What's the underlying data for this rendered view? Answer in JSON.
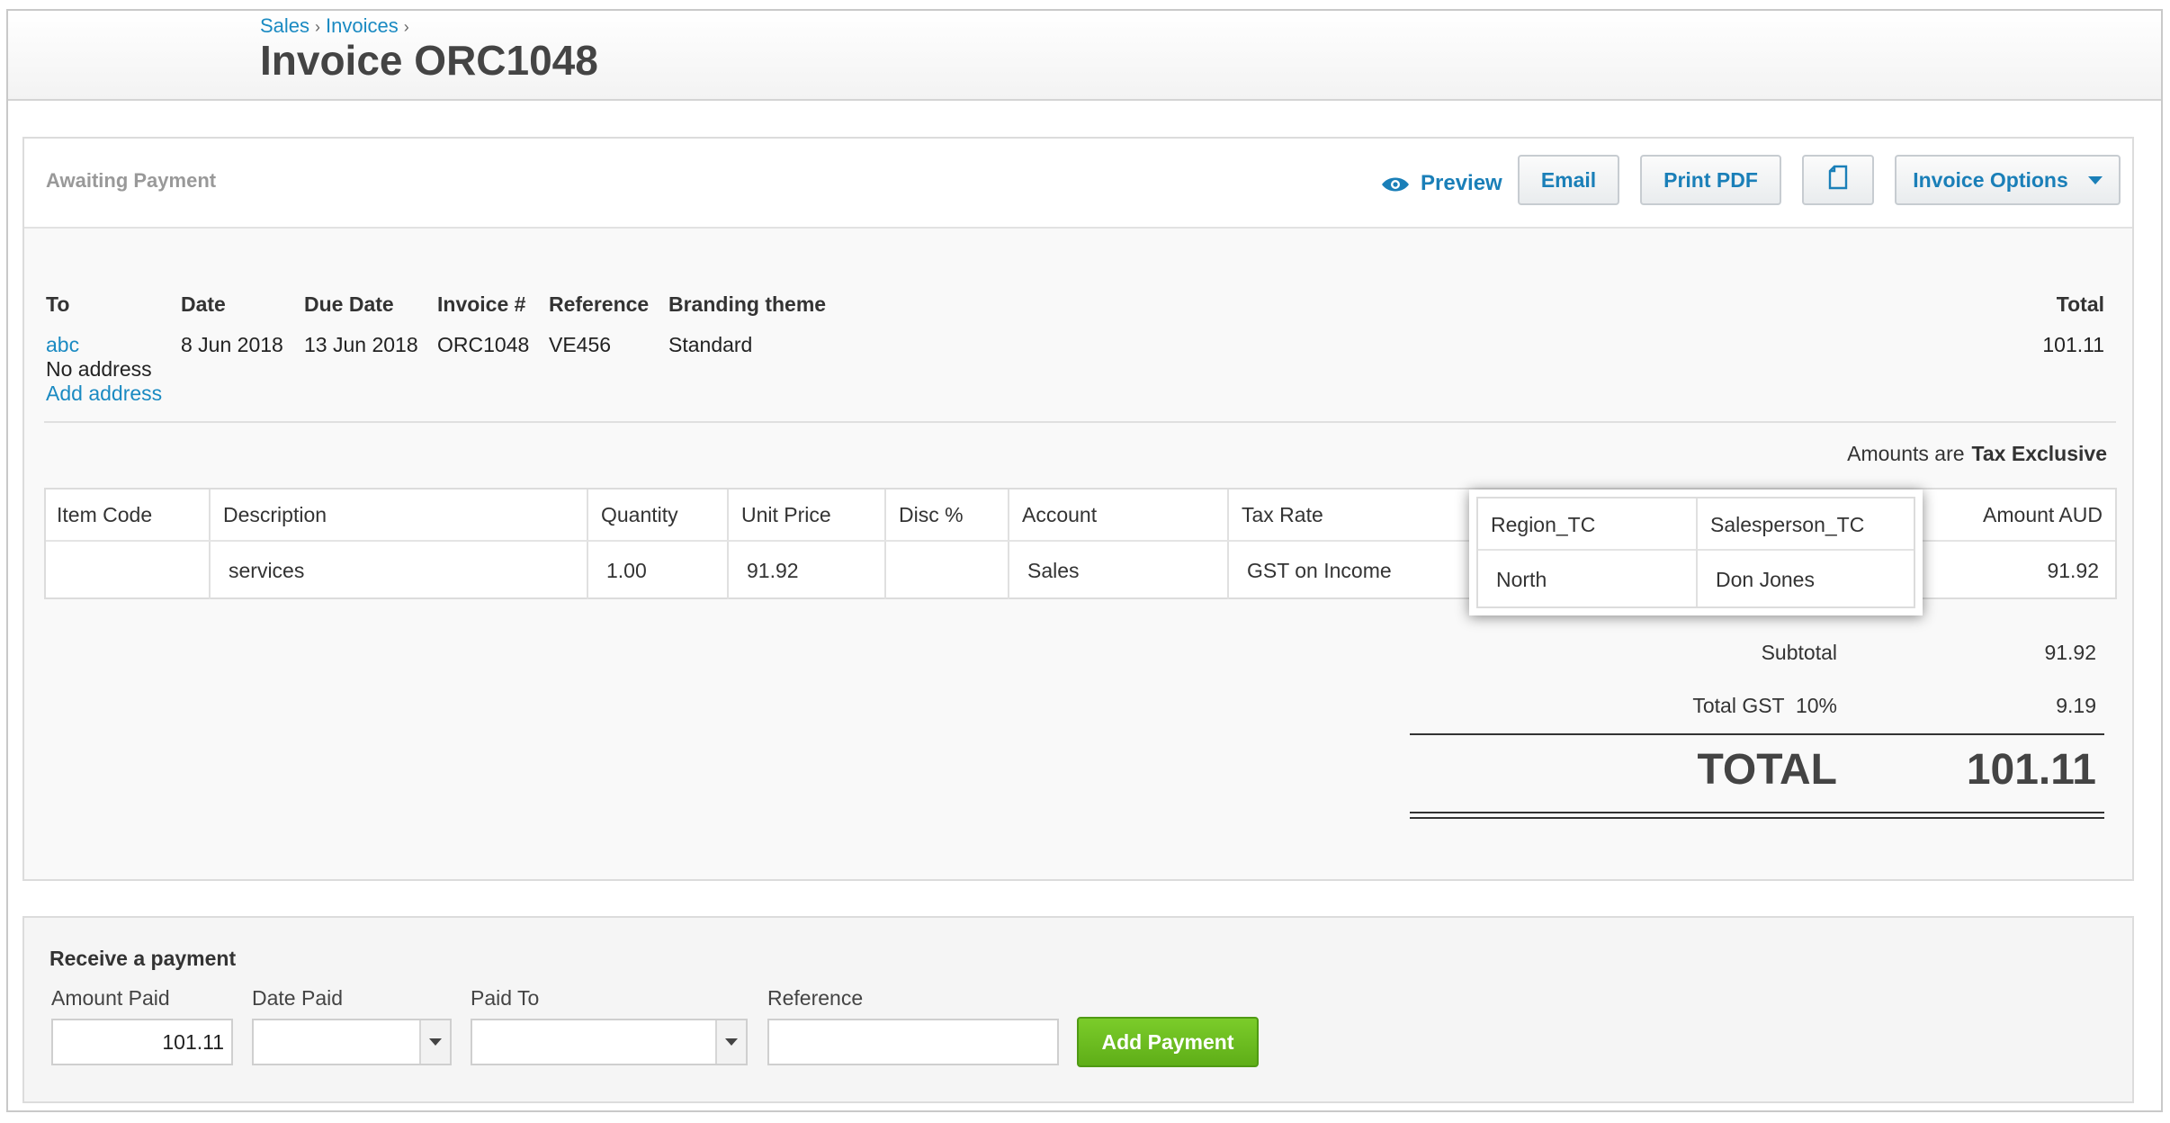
{
  "breadcrumb": {
    "items": [
      "Sales",
      "Invoices"
    ],
    "separator": "›"
  },
  "page": {
    "title": "Invoice ORC1048"
  },
  "status": "Awaiting Payment",
  "toolbar": {
    "preview_label": "Preview",
    "email_label": "Email",
    "print_label": "Print PDF",
    "options_label": "Invoice Options",
    "preview_icon": "eye-icon",
    "copy_icon": "copy-icon",
    "options_icon": "chevron-down-icon"
  },
  "invoice": {
    "headers": {
      "to": "To",
      "date": "Date",
      "due_date": "Due Date",
      "number": "Invoice #",
      "reference": "Reference",
      "branding": "Branding theme",
      "total": "Total"
    },
    "to": {
      "contact": "abc",
      "address": "No address",
      "add_address": "Add address"
    },
    "date": "8 Jun 2018",
    "due_date": "13 Jun 2018",
    "number": "ORC1048",
    "reference": "VE456",
    "branding": "Standard",
    "total": "101.11"
  },
  "amounts_note": {
    "label": "Amounts are",
    "value": "Tax Exclusive"
  },
  "items": {
    "columns": [
      "Item Code",
      "Description",
      "Quantity",
      "Unit Price",
      "Disc %",
      "Account",
      "Tax Rate",
      "Region_TC",
      "Salesperson_TC",
      "Amount AUD"
    ],
    "rows": [
      {
        "item_code": "",
        "description": "services",
        "quantity": "1.00",
        "unit_price": "91.92",
        "disc": "",
        "account": "Sales",
        "tax_rate": "GST on Income",
        "region": "North",
        "salesperson": "Don Jones",
        "amount": "91.92"
      }
    ]
  },
  "totals": {
    "subtotal_label": "Subtotal",
    "subtotal": "91.92",
    "gst_label": "Total GST  10%",
    "gst": "9.19",
    "total_label": "TOTAL",
    "total": "101.11"
  },
  "payment": {
    "title": "Receive a payment",
    "amount_label": "Amount Paid",
    "amount_value": "101.11",
    "date_label": "Date Paid",
    "date_value": "",
    "paid_to_label": "Paid To",
    "paid_to_value": "",
    "reference_label": "Reference",
    "reference_value": "",
    "add_label": "Add Payment"
  },
  "colors": {
    "link": "#1a8ac2",
    "button_text": "#1a7fb8",
    "add_payment": "#6dbd20",
    "status": "#999999"
  }
}
